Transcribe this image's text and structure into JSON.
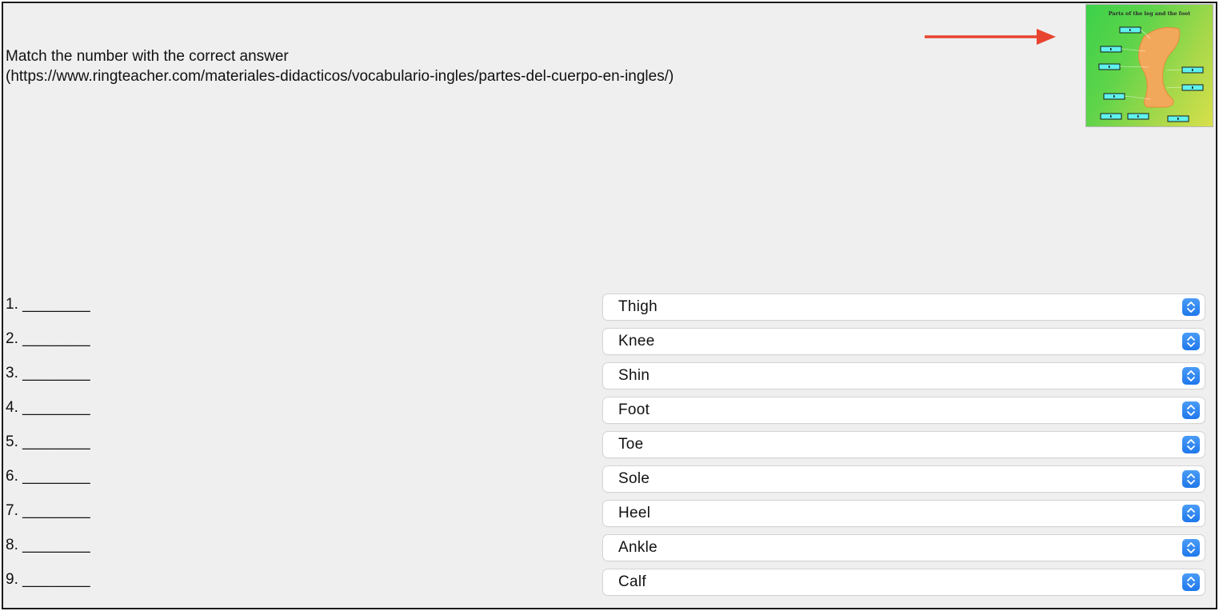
{
  "instructions": {
    "line1": "Match the number with the correct answer",
    "line2": "(https://www.ringteacher.com/materiales-didacticos/vocabulario-ingles/partes-del-cuerpo-en-ingles/)"
  },
  "thumbnail": {
    "title": "Parts of the leg and the foot"
  },
  "colors": {
    "arrow": "#e8442f",
    "stepper": "#2c83f0",
    "panel": "#efefef"
  },
  "rows": [
    {
      "label": "1. ________",
      "selected": "Thigh"
    },
    {
      "label": "2. ________",
      "selected": "Knee"
    },
    {
      "label": "3. ________",
      "selected": "Shin"
    },
    {
      "label": "4. ________",
      "selected": "Foot"
    },
    {
      "label": "5. ________",
      "selected": "Toe"
    },
    {
      "label": "6. ________",
      "selected": "Sole"
    },
    {
      "label": "7. ________",
      "selected": "Heel"
    },
    {
      "label": "8. ________",
      "selected": "Ankle"
    },
    {
      "label": "9. ________",
      "selected": "Calf"
    }
  ]
}
